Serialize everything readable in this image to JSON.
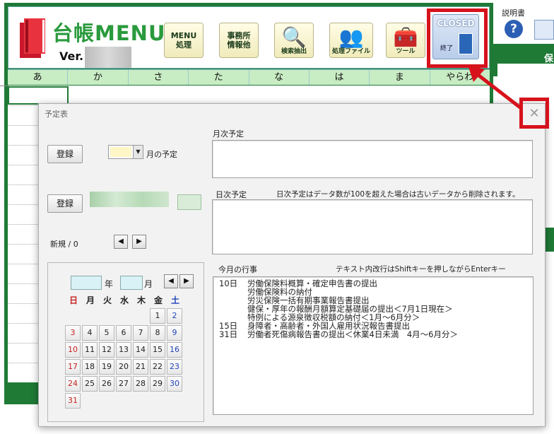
{
  "app": {
    "title": "台帳MENU",
    "version_label": "Ver.",
    "toolbar": [
      {
        "id": "menu",
        "label": "MENU\n処理"
      },
      {
        "id": "office",
        "label": "事務所\n情報他"
      },
      {
        "id": "search",
        "label": "検索抽出"
      },
      {
        "id": "process",
        "label": "処理ファイル"
      },
      {
        "id": "tools",
        "label": "ツール"
      }
    ],
    "closed": {
      "title": "CLOSED",
      "label": "終了"
    },
    "kana_tabs": [
      "あ",
      "か",
      "さ",
      "た",
      "な",
      "は",
      "ま",
      "やらわ"
    ]
  },
  "right": {
    "help_label": "説明書",
    "help_icon": "?",
    "partial_header": "保"
  },
  "dialog": {
    "title": "予定表",
    "close_icon": "✕",
    "monthly": {
      "register": "登録",
      "month_suffix": "月の予定",
      "panel_label": "月次予定"
    },
    "daily": {
      "register": "登録",
      "panel_label": "日次予定",
      "note": "日次予定はデータ数が100を超えた場合は古いデータから削除されます。",
      "counter": "新規 / 0"
    },
    "nav": {
      "prev": "◀",
      "next": "▶"
    },
    "calendar": {
      "year_unit": "年",
      "month_unit": "月",
      "weekdays": [
        "日",
        "月",
        "火",
        "水",
        "木",
        "金",
        "土"
      ],
      "days": [
        [
          "",
          "",
          "",
          "",
          "",
          "1",
          "2"
        ],
        [
          "3",
          "4",
          "5",
          "6",
          "7",
          "8",
          "9"
        ],
        [
          "10",
          "11",
          "12",
          "13",
          "14",
          "15",
          "16"
        ],
        [
          "17",
          "18",
          "19",
          "20",
          "21",
          "22",
          "23"
        ],
        [
          "24",
          "25",
          "26",
          "27",
          "28",
          "29",
          "30"
        ],
        [
          "31",
          "",
          "",
          "",
          "",
          "",
          ""
        ]
      ]
    },
    "events": {
      "panel_label": "今月の行事",
      "hint": "テキスト内改行はShiftキーを押しながらEnterキー",
      "items": [
        {
          "day": "10日",
          "text": "労働保険料概算・確定申告書の提出"
        },
        {
          "day": "",
          "text": "労働保険料の納付"
        },
        {
          "day": "",
          "text": "労災保険一括有期事業報告書提出"
        },
        {
          "day": "",
          "text": "健保・厚年の報酬月額算定基礎届の提出＜7月1日現在＞"
        },
        {
          "day": "",
          "text": "特例による源泉徴収税額の納付＜1月～6月分＞"
        },
        {
          "day": "15日",
          "text": "身障者・高齢者・外国人雇用状況報告書提出"
        },
        {
          "day": "31日",
          "text": "労働者死傷病報告書の提出＜休業4日未満　4月～6月分＞"
        }
      ]
    }
  }
}
